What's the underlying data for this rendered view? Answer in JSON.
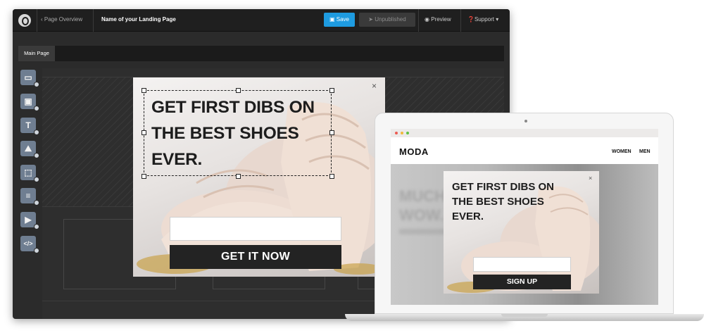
{
  "editor": {
    "topbar": {
      "back_label": "‹ Page Overview",
      "page_name": "Name of your Landing Page",
      "save_label": "Save",
      "unpublished_label": "Unpublished",
      "preview_label": "Preview",
      "support_label": "Support ▾"
    },
    "tabs": [
      {
        "label": "Main Page"
      }
    ],
    "tools": [
      {
        "icon": "section-icon",
        "glyph": "▭"
      },
      {
        "icon": "box-icon",
        "glyph": "▣"
      },
      {
        "icon": "text-icon",
        "glyph": "T"
      },
      {
        "icon": "image-icon",
        "glyph": "⛰"
      },
      {
        "icon": "button-icon",
        "glyph": "⬚"
      },
      {
        "icon": "form-icon",
        "glyph": "≡"
      },
      {
        "icon": "video-icon",
        "glyph": "▶"
      },
      {
        "icon": "code-icon",
        "glyph": "</>"
      }
    ],
    "popup": {
      "headline": "GET FIRST DIBS ON THE BEST SHOES EVER.",
      "cta_label": "GET IT NOW",
      "close_glyph": "×"
    }
  },
  "preview": {
    "site_logo": "MODA",
    "nav": [
      "WOMEN",
      "MEN"
    ],
    "hero_blur_text": "MUCH WOW.",
    "popup": {
      "headline": "GET FIRST DIBS ON THE BEST SHOES EVER.",
      "cta_label": "SIGN UP",
      "close_glyph": "×"
    }
  },
  "colors": {
    "save_button": "#1e9be0",
    "cta": "#232323",
    "editor_bg": "#2b2b2b",
    "tool_bg": "#6f7e91",
    "traffic_red": "#ec5b52",
    "traffic_yellow": "#f0b93a",
    "traffic_green": "#5fc145"
  }
}
